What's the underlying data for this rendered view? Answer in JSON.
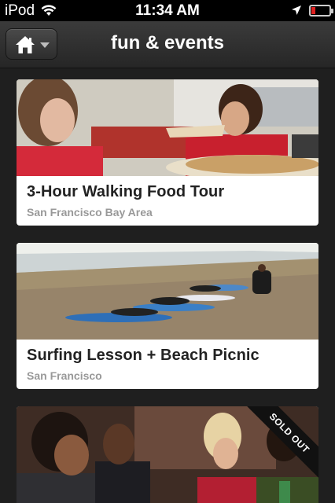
{
  "status_bar": {
    "carrier": "iPod",
    "time": "11:34 AM"
  },
  "nav": {
    "title": "fun & events",
    "home_icon": "home-icon"
  },
  "cards": [
    {
      "title": "3-Hour Walking Food Tour",
      "subtitle": "San Francisco Bay Area",
      "badge": ""
    },
    {
      "title": "Surfing Lesson + Beach Picnic",
      "subtitle": "San Francisco",
      "badge": ""
    },
    {
      "title": "",
      "subtitle": "",
      "badge": "SOLD OUT"
    }
  ],
  "colors": {
    "background": "#1f1f1f",
    "card": "#ffffff",
    "title_text": "#222222",
    "subtitle_text": "#999999",
    "battery_low": "#e02020"
  }
}
